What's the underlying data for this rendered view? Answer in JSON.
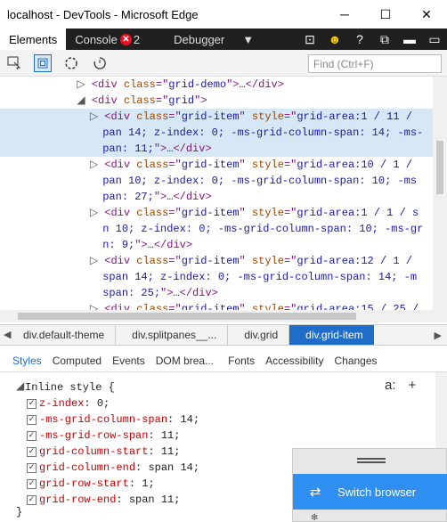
{
  "window": {
    "title": "localhost - DevTools - Microsoft Edge"
  },
  "tabs": [
    {
      "label": "Elements",
      "active": true
    },
    {
      "label": "Console",
      "badge_count": "2"
    },
    {
      "label": "Debugger"
    }
  ],
  "toolbar": {
    "find_placeholder": "Find (Ctrl+F)"
  },
  "dom_lines": [
    {
      "type": "tag",
      "indent": "            ",
      "arrow": "▷ ",
      "parts": [
        [
          "tag",
          "<div "
        ],
        [
          "attr",
          "class"
        ],
        [
          "tag",
          "=\""
        ],
        [
          "val",
          "grid-demo"
        ],
        [
          "tag",
          "\">"
        ],
        [
          "txt",
          "…"
        ],
        [
          "tag",
          "</div>"
        ]
      ]
    },
    {
      "type": "tag",
      "indent": "            ",
      "arrow": "◢ ",
      "parts": [
        [
          "tag",
          "<div "
        ],
        [
          "attr",
          "class"
        ],
        [
          "tag",
          "=\""
        ],
        [
          "val",
          "grid"
        ],
        [
          "tag",
          "\">"
        ]
      ]
    },
    {
      "type": "sel",
      "indent": "              ",
      "arrow": "▷ ",
      "parts": [
        [
          "tag",
          "<div "
        ],
        [
          "attr",
          "class"
        ],
        [
          "tag",
          "=\""
        ],
        [
          "val",
          "grid-item"
        ],
        [
          "tag",
          "\" "
        ],
        [
          "attr",
          "style"
        ],
        [
          "tag",
          "=\""
        ],
        [
          "val",
          "grid-area:1 / 11 /"
        ]
      ]
    },
    {
      "type": "sel",
      "indent": "                ",
      "arrow": "",
      "parts": [
        [
          "val",
          "pan 14; z-index: 0; -ms-grid-column-span: 14; -ms-"
        ]
      ]
    },
    {
      "type": "sel",
      "indent": "                ",
      "arrow": "",
      "parts": [
        [
          "val",
          "pan: 11;"
        ],
        [
          "tag",
          "\">"
        ],
        [
          "txt",
          "…"
        ],
        [
          "tag",
          "</div>"
        ]
      ]
    },
    {
      "type": "tag",
      "indent": "              ",
      "arrow": "▷ ",
      "parts": [
        [
          "tag",
          "<div "
        ],
        [
          "attr",
          "class"
        ],
        [
          "tag",
          "=\""
        ],
        [
          "val",
          "grid-item"
        ],
        [
          "tag",
          "\" "
        ],
        [
          "attr",
          "style"
        ],
        [
          "tag",
          "=\""
        ],
        [
          "val",
          "grid-area:10 / 1 /"
        ]
      ]
    },
    {
      "type": "tag",
      "indent": "                ",
      "arrow": "",
      "parts": [
        [
          "val",
          "pan 10; z-index: 0; -ms-grid-column-span: 10; -ms"
        ]
      ]
    },
    {
      "type": "tag",
      "indent": "                ",
      "arrow": "",
      "parts": [
        [
          "val",
          "pan: 27;"
        ],
        [
          "tag",
          "\">"
        ],
        [
          "txt",
          "…"
        ],
        [
          "tag",
          "</div>"
        ]
      ]
    },
    {
      "type": "tag",
      "indent": "              ",
      "arrow": "▷ ",
      "parts": [
        [
          "tag",
          "<div "
        ],
        [
          "attr",
          "class"
        ],
        [
          "tag",
          "=\""
        ],
        [
          "val",
          "grid-item"
        ],
        [
          "tag",
          "\" "
        ],
        [
          "attr",
          "style"
        ],
        [
          "tag",
          "=\""
        ],
        [
          "val",
          "grid-area:1 / 1 / s"
        ]
      ]
    },
    {
      "type": "tag",
      "indent": "                ",
      "arrow": "",
      "parts": [
        [
          "val",
          "n 10; z-index: 0; -ms-grid-column-span: 10; -ms-gr"
        ]
      ]
    },
    {
      "type": "tag",
      "indent": "                ",
      "arrow": "",
      "parts": [
        [
          "val",
          "n: 9;"
        ],
        [
          "tag",
          "\">"
        ],
        [
          "txt",
          "…"
        ],
        [
          "tag",
          "</div>"
        ]
      ]
    },
    {
      "type": "tag",
      "indent": "              ",
      "arrow": "▷ ",
      "parts": [
        [
          "tag",
          "<div "
        ],
        [
          "attr",
          "class"
        ],
        [
          "tag",
          "=\""
        ],
        [
          "val",
          "grid-item"
        ],
        [
          "tag",
          "\" "
        ],
        [
          "attr",
          "style"
        ],
        [
          "tag",
          "=\""
        ],
        [
          "val",
          "grid-area:12 / 1 /"
        ]
      ]
    },
    {
      "type": "tag",
      "indent": "                ",
      "arrow": "",
      "parts": [
        [
          "val",
          "span 14; z-index: 0; -ms-grid-column-span: 14; -m"
        ]
      ]
    },
    {
      "type": "tag",
      "indent": "                ",
      "arrow": "",
      "parts": [
        [
          "val",
          "span: 25;"
        ],
        [
          "tag",
          "\">"
        ],
        [
          "txt",
          "…"
        ],
        [
          "tag",
          "</div>"
        ]
      ]
    },
    {
      "type": "tag",
      "indent": "              ",
      "arrow": "▷ ",
      "parts": [
        [
          "tag",
          "<div "
        ],
        [
          "attr",
          "class"
        ],
        [
          "tag",
          "=\""
        ],
        [
          "val",
          "grid-item"
        ],
        [
          "tag",
          "\" "
        ],
        [
          "attr",
          "style"
        ],
        [
          "tag",
          "=\""
        ],
        [
          "val",
          "grid-area:15 / 25 /"
        ]
      ]
    }
  ],
  "breadcrumb": [
    "div.default-theme",
    "div.splitpanes__...",
    "div.grid",
    "div.grid-item"
  ],
  "subtabs": [
    "Styles",
    "Computed",
    "Events",
    "DOM brea...",
    "Fonts",
    "Accessibility",
    "Changes"
  ],
  "styles": {
    "rule_head": "Inline style  {",
    "props": [
      {
        "name": "z-index",
        "value": "0"
      },
      {
        "name": "-ms-grid-column-span",
        "value": "14"
      },
      {
        "name": "-ms-grid-row-span",
        "value": "11"
      },
      {
        "name": "grid-column-start",
        "value": "11"
      },
      {
        "name": "grid-column-end",
        "value": "span 14"
      },
      {
        "name": "grid-row-start",
        "value": "1"
      },
      {
        "name": "grid-row-end",
        "value": "span 11"
      }
    ],
    "close": "}",
    "actions": [
      "a:",
      "+"
    ]
  },
  "popup": {
    "label": "Switch browser"
  }
}
